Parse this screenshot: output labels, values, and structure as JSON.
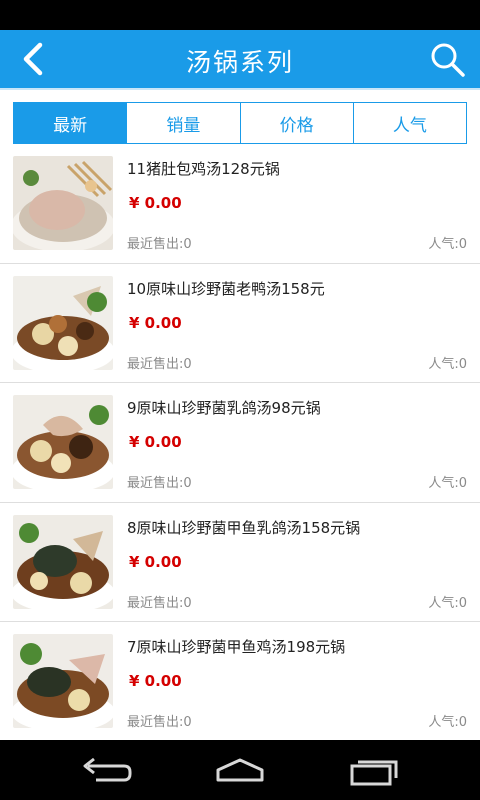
{
  "header": {
    "title": "汤锅系列",
    "back_icon": "back-chevron-icon",
    "search_icon": "search-icon",
    "color": "#1a9be8"
  },
  "tabs": [
    {
      "label": "最新",
      "active": true
    },
    {
      "label": "销量",
      "active": false
    },
    {
      "label": "价格",
      "active": false
    },
    {
      "label": "人气",
      "active": false
    }
  ],
  "items": [
    {
      "name": "11猪肚包鸡汤128元锅",
      "price": "¥ 0.00",
      "recent_sold": "最近售出:0",
      "popularity": "人气:0"
    },
    {
      "name": "10原味山珍野菌老鸭汤158元",
      "price": "¥ 0.00",
      "recent_sold": "最近售出:0",
      "popularity": "人气:0"
    },
    {
      "name": "9原味山珍野菌乳鸽汤98元锅",
      "price": "¥ 0.00",
      "recent_sold": "最近售出:0",
      "popularity": "人气:0"
    },
    {
      "name": "8原味山珍野菌甲鱼乳鸽汤158元锅",
      "price": "¥ 0.00",
      "recent_sold": "最近售出:0",
      "popularity": "人气:0"
    },
    {
      "name": "7原味山珍野菌甲鱼鸡汤198元锅",
      "price": "¥ 0.00",
      "recent_sold": "最近售出:0",
      "popularity": "人气:0"
    }
  ],
  "system_nav": {
    "back_icon": "nav-back-icon",
    "home_icon": "nav-home-icon",
    "recents_icon": "nav-recents-icon"
  }
}
